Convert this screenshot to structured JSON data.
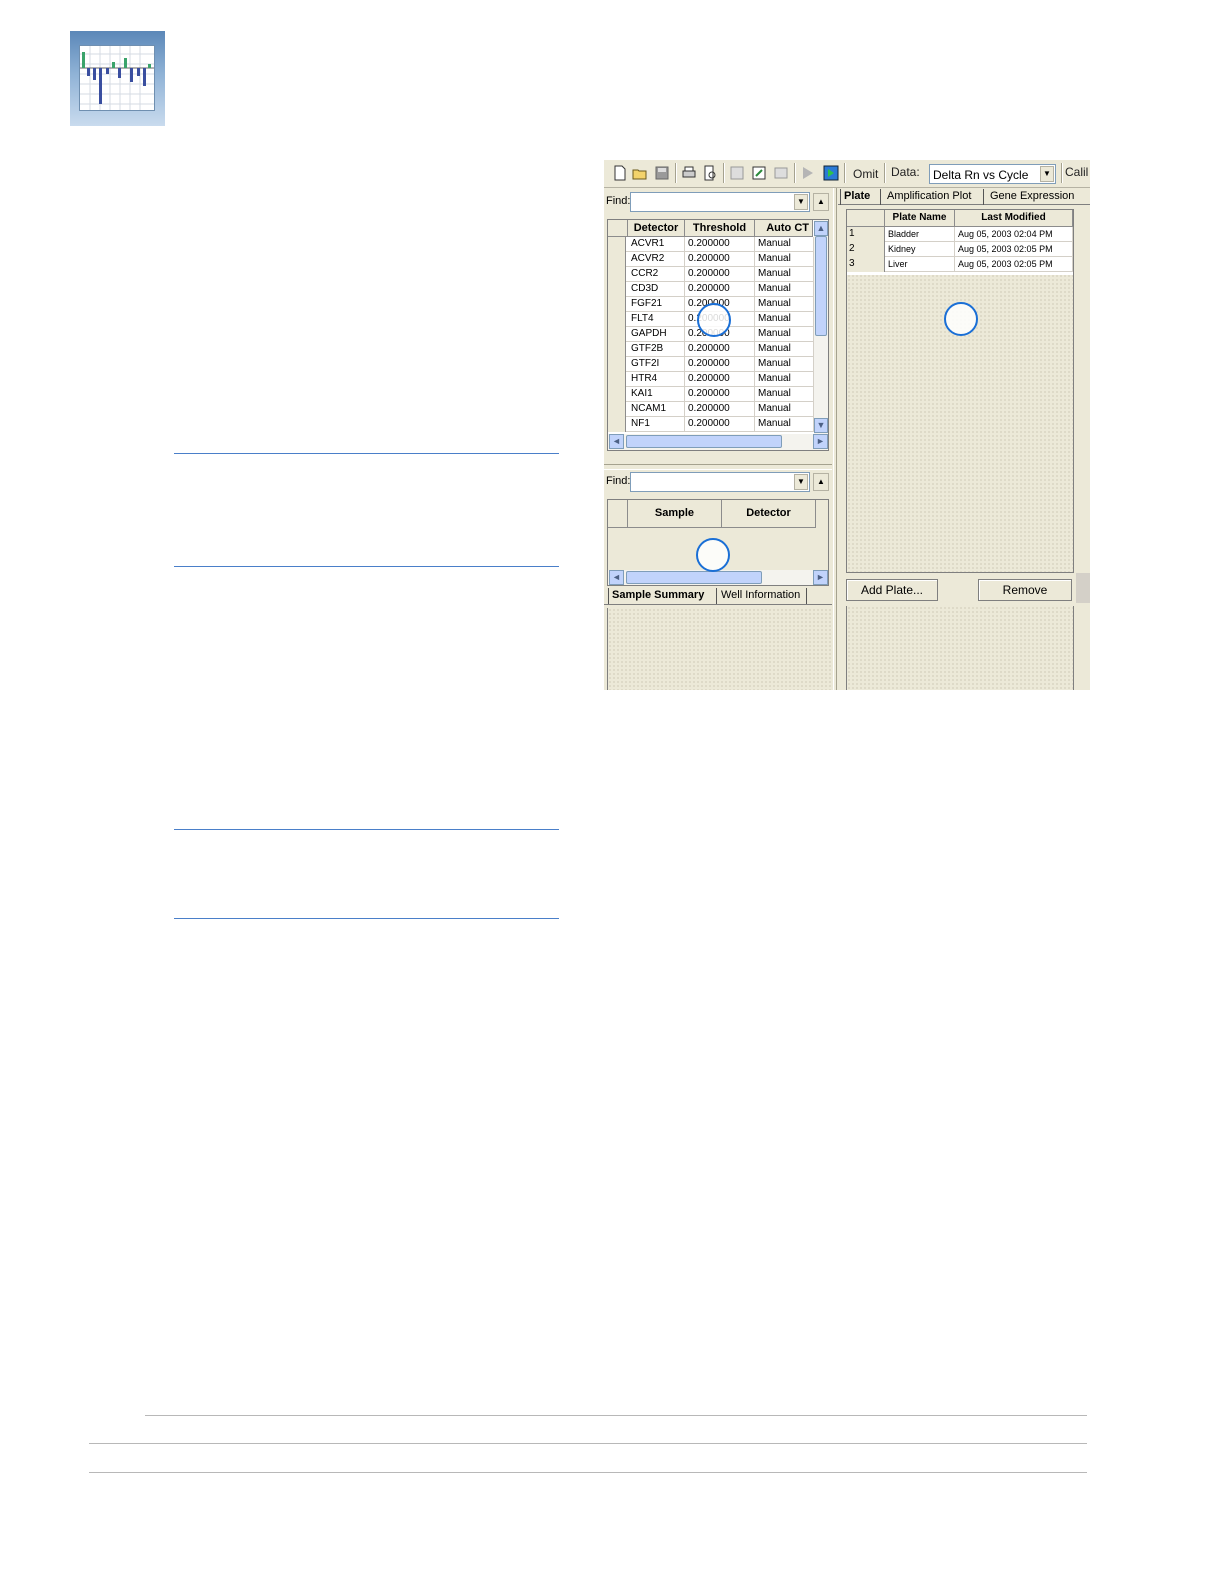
{
  "toolbar": {
    "omit_label": "Omit",
    "data_label": "Data:",
    "data_value": "Delta Rn vs Cycle",
    "calib_label": "Calil"
  },
  "detector_pane": {
    "find_label": "Find:",
    "columns": [
      "Detector",
      "Threshold",
      "Auto CT"
    ],
    "rows": [
      [
        "ACVR1",
        "0.200000",
        "Manual"
      ],
      [
        "ACVR2",
        "0.200000",
        "Manual"
      ],
      [
        "CCR2",
        "0.200000",
        "Manual"
      ],
      [
        "CD3D",
        "0.200000",
        "Manual"
      ],
      [
        "FGF21",
        "0.200000",
        "Manual"
      ],
      [
        "FLT4",
        "0.200000",
        "Manual"
      ],
      [
        "GAPDH",
        "0.200000",
        "Manual"
      ],
      [
        "GTF2B",
        "0.200000",
        "Manual"
      ],
      [
        "GTF2I",
        "0.200000",
        "Manual"
      ],
      [
        "HTR4",
        "0.200000",
        "Manual"
      ],
      [
        "KAI1",
        "0.200000",
        "Manual"
      ],
      [
        "NCAM1",
        "0.200000",
        "Manual"
      ],
      [
        "NF1",
        "0.200000",
        "Manual"
      ]
    ]
  },
  "sample_pane": {
    "find_label": "Find:",
    "columns": [
      "Sample",
      "Detector"
    ],
    "tabs": [
      "Sample Summary",
      "Well Information"
    ]
  },
  "plate_pane": {
    "tabs": [
      "Plate",
      "Amplification Plot",
      "Gene Expression"
    ],
    "columns": [
      "Plate Name",
      "Last Modified"
    ],
    "rows": [
      [
        "1",
        "Bladder",
        "Aug 05, 2003 02:04 PM"
      ],
      [
        "2",
        "Kidney",
        "Aug 05, 2003 02:05 PM"
      ],
      [
        "3",
        "Liver",
        "Aug 05, 2003 02:05 PM"
      ]
    ],
    "add_button": "Add Plate...",
    "remove_button": "Remove"
  },
  "colors": {
    "window_bg": "#ece9d8",
    "accent_blue": "#1a6fd6",
    "rule_blue": "#4a7fc9"
  }
}
